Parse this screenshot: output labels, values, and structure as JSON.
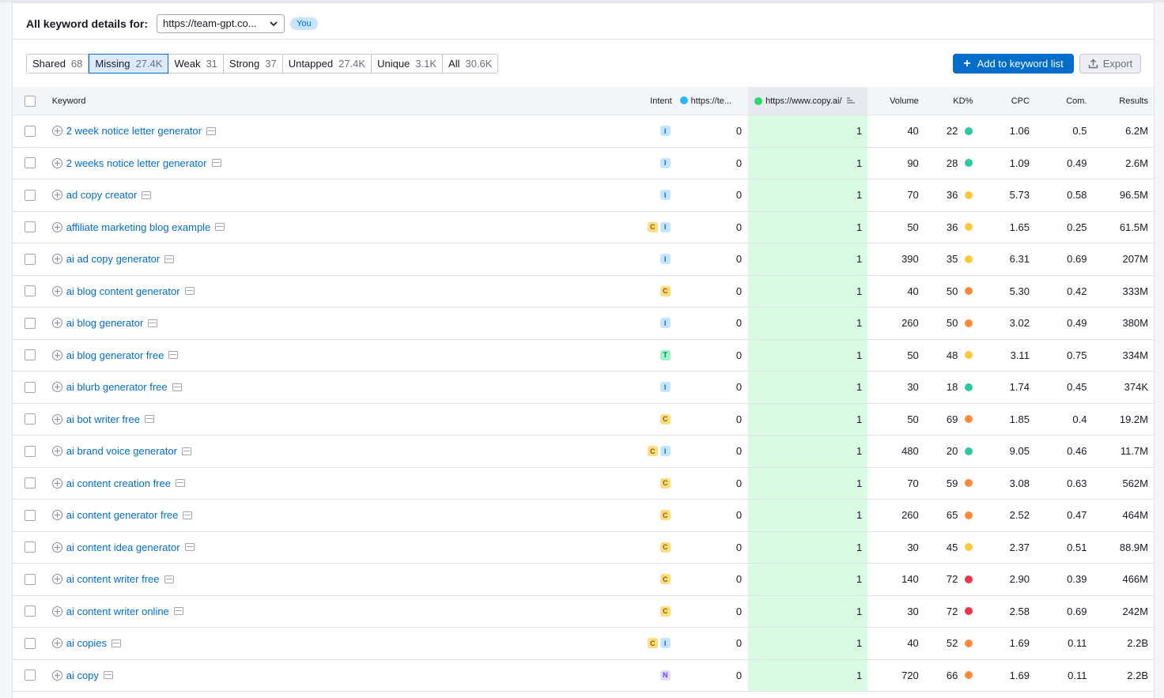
{
  "header": {
    "title": "All keyword details for:",
    "domain_value": "https://team-gpt.co...",
    "you_badge": "You"
  },
  "filters": [
    {
      "label": "Shared",
      "count": "68",
      "active": false
    },
    {
      "label": "Missing",
      "count": "27.4K",
      "active": true
    },
    {
      "label": "Weak",
      "count": "31",
      "active": false
    },
    {
      "label": "Strong",
      "count": "37",
      "active": false
    },
    {
      "label": "Untapped",
      "count": "27.4K",
      "active": false
    },
    {
      "label": "Unique",
      "count": "3.1K",
      "active": false
    },
    {
      "label": "All",
      "count": "30.6K",
      "active": false
    }
  ],
  "actions": {
    "add_label": "Add to keyword list",
    "export_label": "Export"
  },
  "colors": {
    "accent": "#006dca",
    "you_dot": "#2bb7f5",
    "competitor_dot": "#2bd96e",
    "kd_green": "#2ec8a0",
    "kd_yellow": "#ffc83d",
    "kd_orange": "#ff8a3d",
    "kd_red": "#f0334f"
  },
  "table": {
    "headers": {
      "keyword": "Keyword",
      "intent": "Intent",
      "you_domain": "https://te...",
      "competitor_domain": "https://www.copy.ai/",
      "volume": "Volume",
      "kd": "KD%",
      "cpc": "CPC",
      "com": "Com.",
      "results": "Results"
    },
    "rows": [
      {
        "kw": "2 week notice letter generator",
        "intent": [
          "I"
        ],
        "you": "0",
        "comp": "1",
        "vol": "40",
        "kd": "22",
        "kdc": "green",
        "cpc": "1.06",
        "com": "0.5",
        "res": "6.2M"
      },
      {
        "kw": "2 weeks notice letter generator",
        "intent": [
          "I"
        ],
        "you": "0",
        "comp": "1",
        "vol": "90",
        "kd": "28",
        "kdc": "green",
        "cpc": "1.09",
        "com": "0.49",
        "res": "2.6M"
      },
      {
        "kw": "ad copy creator",
        "intent": [
          "I"
        ],
        "you": "0",
        "comp": "1",
        "vol": "70",
        "kd": "36",
        "kdc": "yellow",
        "cpc": "5.73",
        "com": "0.58",
        "res": "96.5M"
      },
      {
        "kw": "affiliate marketing blog example",
        "intent": [
          "C",
          "I"
        ],
        "you": "0",
        "comp": "1",
        "vol": "50",
        "kd": "36",
        "kdc": "yellow",
        "cpc": "1.65",
        "com": "0.25",
        "res": "61.5M"
      },
      {
        "kw": "ai ad copy generator",
        "intent": [
          "I"
        ],
        "you": "0",
        "comp": "1",
        "vol": "390",
        "kd": "35",
        "kdc": "yellow",
        "cpc": "6.31",
        "com": "0.69",
        "res": "207M"
      },
      {
        "kw": "ai blog content generator",
        "intent": [
          "C"
        ],
        "you": "0",
        "comp": "1",
        "vol": "40",
        "kd": "50",
        "kdc": "orange",
        "cpc": "5.30",
        "com": "0.42",
        "res": "333M"
      },
      {
        "kw": "ai blog generator",
        "intent": [
          "I"
        ],
        "you": "0",
        "comp": "1",
        "vol": "260",
        "kd": "50",
        "kdc": "orange",
        "cpc": "3.02",
        "com": "0.49",
        "res": "380M"
      },
      {
        "kw": "ai blog generator free",
        "intent": [
          "T"
        ],
        "you": "0",
        "comp": "1",
        "vol": "50",
        "kd": "48",
        "kdc": "yellow",
        "cpc": "3.11",
        "com": "0.75",
        "res": "334M"
      },
      {
        "kw": "ai blurb generator free",
        "intent": [
          "I"
        ],
        "you": "0",
        "comp": "1",
        "vol": "30",
        "kd": "18",
        "kdc": "green",
        "cpc": "1.74",
        "com": "0.45",
        "res": "374K"
      },
      {
        "kw": "ai bot writer free",
        "intent": [
          "C"
        ],
        "you": "0",
        "comp": "1",
        "vol": "50",
        "kd": "69",
        "kdc": "orange",
        "cpc": "1.85",
        "com": "0.4",
        "res": "19.2M"
      },
      {
        "kw": "ai brand voice generator",
        "intent": [
          "C",
          "I"
        ],
        "you": "0",
        "comp": "1",
        "vol": "480",
        "kd": "20",
        "kdc": "green",
        "cpc": "9.05",
        "com": "0.46",
        "res": "11.7M"
      },
      {
        "kw": "ai content creation free",
        "intent": [
          "C"
        ],
        "you": "0",
        "comp": "1",
        "vol": "70",
        "kd": "59",
        "kdc": "orange",
        "cpc": "3.08",
        "com": "0.63",
        "res": "562M"
      },
      {
        "kw": "ai content generator free",
        "intent": [
          "C"
        ],
        "you": "0",
        "comp": "1",
        "vol": "260",
        "kd": "65",
        "kdc": "orange",
        "cpc": "2.52",
        "com": "0.47",
        "res": "464M"
      },
      {
        "kw": "ai content idea generator",
        "intent": [
          "C"
        ],
        "you": "0",
        "comp": "1",
        "vol": "30",
        "kd": "45",
        "kdc": "yellow",
        "cpc": "2.37",
        "com": "0.51",
        "res": "88.9M"
      },
      {
        "kw": "ai content writer free",
        "intent": [
          "C"
        ],
        "you": "0",
        "comp": "1",
        "vol": "140",
        "kd": "72",
        "kdc": "red",
        "cpc": "2.90",
        "com": "0.39",
        "res": "466M"
      },
      {
        "kw": "ai content writer online",
        "intent": [
          "C"
        ],
        "you": "0",
        "comp": "1",
        "vol": "30",
        "kd": "72",
        "kdc": "red",
        "cpc": "2.58",
        "com": "0.69",
        "res": "242M"
      },
      {
        "kw": "ai copies",
        "intent": [
          "C",
          "I"
        ],
        "you": "0",
        "comp": "1",
        "vol": "40",
        "kd": "52",
        "kdc": "orange",
        "cpc": "1.69",
        "com": "0.11",
        "res": "2.2B"
      },
      {
        "kw": "ai copy",
        "intent": [
          "N"
        ],
        "you": "0",
        "comp": "1",
        "vol": "720",
        "kd": "66",
        "kdc": "orange",
        "cpc": "1.69",
        "com": "0.11",
        "res": "2.2B"
      }
    ]
  }
}
